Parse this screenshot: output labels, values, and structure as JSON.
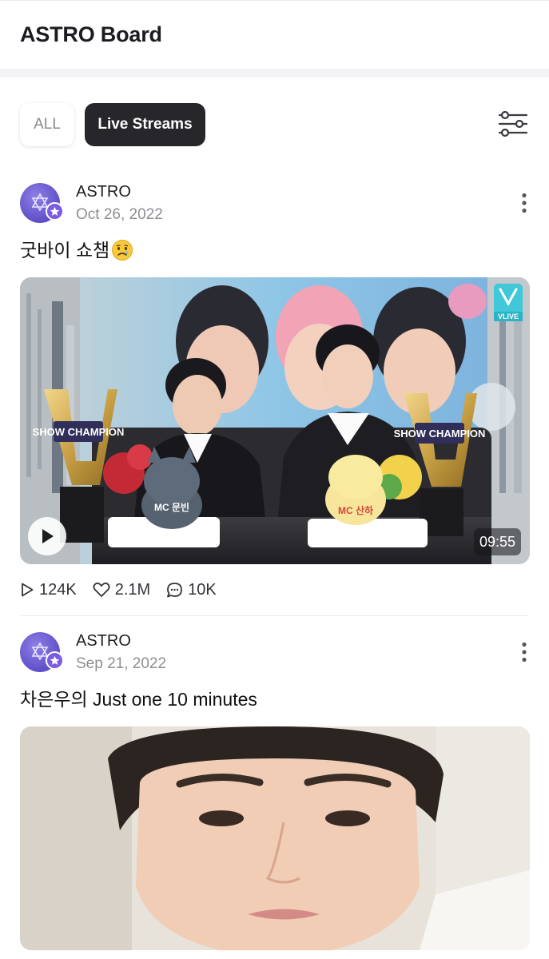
{
  "app": {
    "title": "ASTRO Board"
  },
  "filters": {
    "all_label": "ALL",
    "live_label": "Live Streams",
    "selected": "Live Streams"
  },
  "colors": {
    "accent": "#26262b",
    "avatar": "#6a5bd6",
    "badge": "#7b5ce0"
  },
  "posts": [
    {
      "author": "ASTRO",
      "date": "Oct 26, 2022",
      "text": "굿바이 쇼챔",
      "emoji": "crying-face-emoji",
      "media": {
        "type": "video",
        "duration": "09:55",
        "badge": "VLIVE",
        "trophy_text": "SHOW CHAMPION",
        "cake_left": "MC 문빈",
        "cake_right": "MC 산하"
      },
      "stats": {
        "views": "124K",
        "likes": "2.1M",
        "comments": "10K"
      }
    },
    {
      "author": "ASTRO",
      "date": "Sep 21, 2022",
      "text": "차은우의 Just one 10 minutes",
      "media": {
        "type": "video"
      }
    }
  ],
  "icons": {
    "filter": "sliders-icon",
    "more": "more-vertical-icon",
    "play": "play-icon",
    "views": "play-outline-icon",
    "likes": "heart-icon",
    "comments": "comment-icon",
    "verified": "star-badge-icon"
  }
}
